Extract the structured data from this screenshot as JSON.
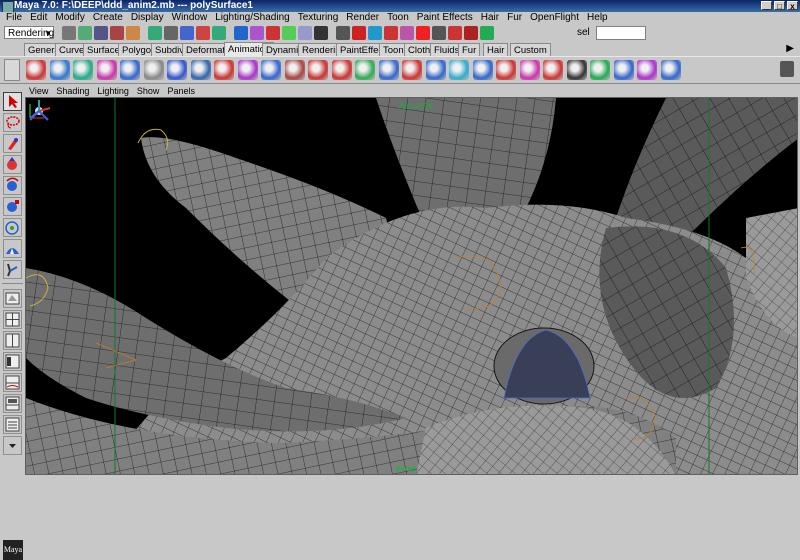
{
  "window": {
    "title": "Maya 7.0: F:\\DEEP\\ddd_anim2.mb  ---  polySurface1",
    "buttons": [
      "_",
      "□",
      "x"
    ]
  },
  "menubar": [
    "File",
    "Edit",
    "Modify",
    "Create",
    "Display",
    "Window",
    "Lighting/Shading",
    "Texturing",
    "Render",
    "Toon",
    "Paint Effects",
    "Hair",
    "Fur",
    "OpenFlight",
    "Help"
  ],
  "status_line": {
    "mode": "Rendering",
    "sel_label": "sel",
    "sel_value": ""
  },
  "shelf_tabs": [
    "General",
    "Curves",
    "Surfaces",
    "Polygons",
    "Subdivs",
    "Deformation",
    "Animation",
    "Dynamics",
    "Rendering",
    "PaintEffects",
    "Toon",
    "Cloth",
    "Fluids",
    "Fur",
    "Hair",
    "Custom"
  ],
  "active_shelf_tab": "Animation",
  "panel_menu": [
    "View",
    "Shading",
    "Lighting",
    "Show",
    "Panels"
  ],
  "viewport": {
    "resolution_readout": "720 x 576",
    "camera_name": "persp"
  },
  "logo_text": "Maya",
  "colors": {
    "mesh_fill": "#7a7a7a",
    "wire": "#1a1a1a",
    "background": "#000000",
    "green_hud": "#00bb33",
    "titlebar": "#0a246a"
  }
}
